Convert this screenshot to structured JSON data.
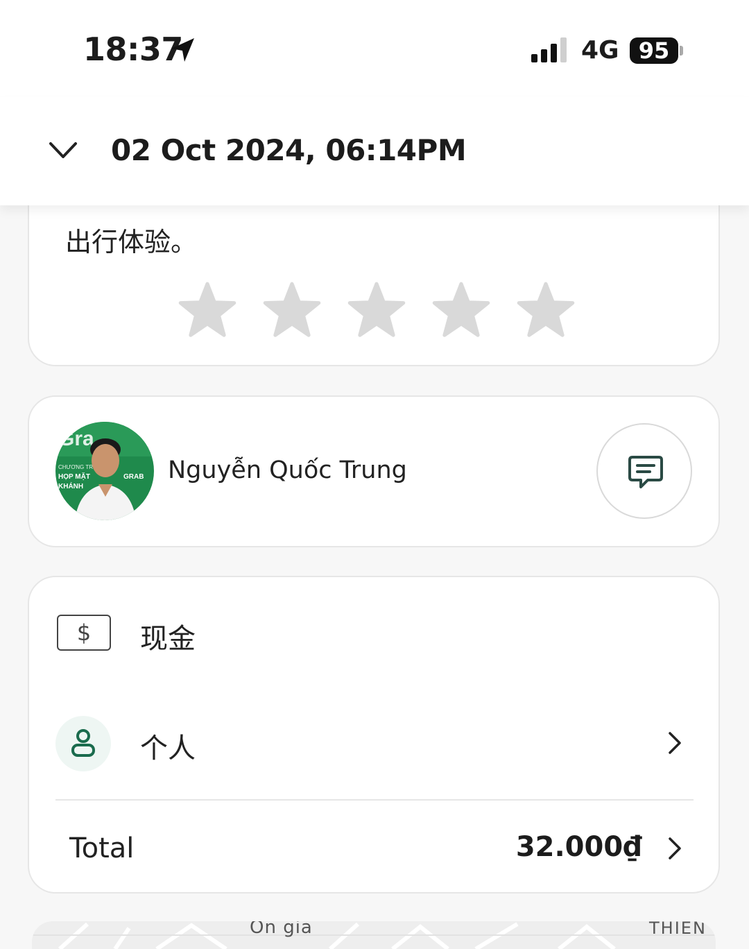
{
  "status_bar": {
    "time": "18:37",
    "network": "4G",
    "battery": "95"
  },
  "header": {
    "title": "02 Oct 2024, 06:14PM"
  },
  "rating_card": {
    "text_tail": "出行体验。",
    "stars_total": 5,
    "stars_selected": 0
  },
  "driver": {
    "name": "Nguyễn Quốc Trung",
    "avatar_text": {
      "top": "Gra",
      "line1": "CHƯƠNG TRÌ",
      "line2": "HỌP MẶT",
      "line3": "KHÁNH",
      "right": "GRAB"
    }
  },
  "payment": {
    "cash_label": "现金",
    "cash_icon_symbol": "$",
    "profile_label": "个人",
    "total_label": "Total",
    "total_value": "32.000₫"
  },
  "map": {
    "label_left": "On gia",
    "label_right": "THIÊN"
  },
  "colors": {
    "accent_green": "#1a6b4d",
    "star_gray": "#d9d9d9"
  }
}
